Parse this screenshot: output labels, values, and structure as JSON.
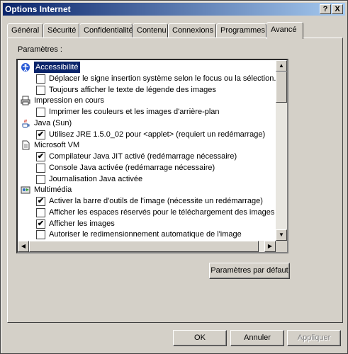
{
  "window": {
    "title": "Options Internet",
    "help_button": "?",
    "close_button": "X"
  },
  "tabs": [
    "Général",
    "Sécurité",
    "Confidentialité",
    "Contenu",
    "Connexions",
    "Programmes",
    "Avancé"
  ],
  "settings_label": "Paramètres :",
  "list": [
    {
      "type": "cat",
      "label": "Accessibilité",
      "icon": "accessibility-icon",
      "selected": true
    },
    {
      "type": "item",
      "label": "Déplacer le signe insertion système selon le focus ou la sélection.",
      "checked": false
    },
    {
      "type": "item",
      "label": "Toujours afficher le texte de légende des images",
      "checked": false
    },
    {
      "type": "cat",
      "label": "Impression en cours",
      "icon": "printer-icon"
    },
    {
      "type": "item",
      "label": "Imprimer les couleurs et les images d'arrière-plan",
      "checked": false
    },
    {
      "type": "cat",
      "label": "Java (Sun)",
      "icon": "java-icon"
    },
    {
      "type": "item",
      "label": "Utilisez JRE 1.5.0_02 pour <applet> (requiert un redémarrage)",
      "checked": true
    },
    {
      "type": "cat",
      "label": "Microsoft VM",
      "icon": "document-icon"
    },
    {
      "type": "item",
      "label": "Compilateur Java JIT activé (redémarrage nécessaire)",
      "checked": true
    },
    {
      "type": "item",
      "label": "Console Java activée (redémarrage nécessaire)",
      "checked": false
    },
    {
      "type": "item",
      "label": "Journalisation Java activée",
      "checked": false
    },
    {
      "type": "cat",
      "label": "Multimédia",
      "icon": "multimedia-icon"
    },
    {
      "type": "item",
      "label": "Activer la barre d'outils de l'image (nécessite un redémarrage)",
      "checked": true
    },
    {
      "type": "item",
      "label": "Afficher les espaces réservés pour le téléchargement des images",
      "checked": false
    },
    {
      "type": "item",
      "label": "Afficher les images",
      "checked": true
    },
    {
      "type": "item",
      "label": "Autoriser le redimensionnement automatique de l'image",
      "checked": false
    }
  ],
  "buttons": {
    "restore_defaults": "Paramètres par défaut",
    "ok": "OK",
    "cancel": "Annuler",
    "apply": "Appliquer"
  }
}
